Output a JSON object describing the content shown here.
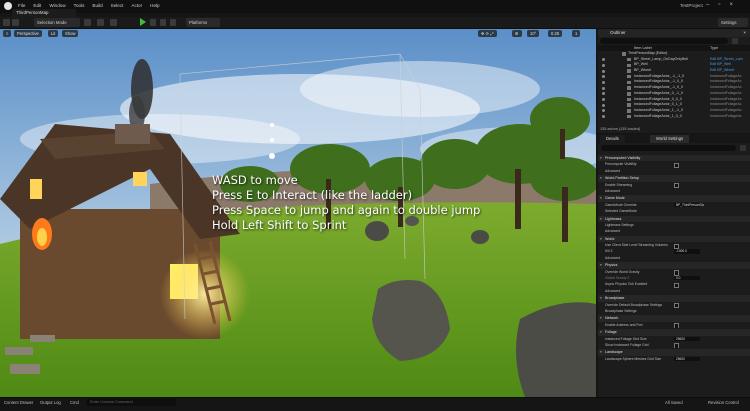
{
  "app": {
    "project_name": "TestProject",
    "map_tab": "ThirdPersonMap",
    "menu": [
      "File",
      "Edit",
      "Window",
      "Tools",
      "Build",
      "Select",
      "Actor",
      "Help"
    ]
  },
  "toolbar": {
    "mode": "Selection Mode",
    "platforms": "Platforms",
    "settings": "Settings"
  },
  "viewport": {
    "perspective": "Perspective",
    "lit": "Lit",
    "show": "Show",
    "snap_angle": "10°",
    "snap_scale": "0.25",
    "camera_speed": "1",
    "instructions": [
      "WASD to move",
      "Press E to Interact (like the ladder)",
      "Press Space to jump and  again to double jump",
      "Hold Left Shift to Sprint"
    ]
  },
  "outliner": {
    "title": "Outliner",
    "col_label": "Item Label",
    "col_type": "Type",
    "root": "ThirdPersonMap (Editor)",
    "rows": [
      {
        "label": "BP_Street_Lamp_OnDayOnlyBell",
        "type": "Edit BP_Street_Lam",
        "link": true
      },
      {
        "label": "BP_Well",
        "type": "Edit BP_Well",
        "link": true
      },
      {
        "label": "BP_Wheel",
        "type": "Edit BP_Wheel",
        "link": true
      },
      {
        "label": "InstancedFoliageActor_-1_-1_0",
        "type": "InstancedFoliageAc",
        "link": false
      },
      {
        "label": "InstancedFoliageActor_-1_0_0",
        "type": "InstancedFoliageAc",
        "link": false
      },
      {
        "label": "InstancedFoliageActor_-1_0_0",
        "type": "InstancedFoliageAc",
        "link": false
      },
      {
        "label": "InstancedFoliageActor_0_-1_0",
        "type": "InstancedFoliageAc",
        "link": false
      },
      {
        "label": "InstancedFoliageActor_0_0_0",
        "type": "InstancedFoliageAc",
        "link": false
      },
      {
        "label": "InstancedFoliageActor_0_1_0",
        "type": "InstancedFoliageAc",
        "link": false
      },
      {
        "label": "InstancedFoliageActor_1_-1_0",
        "type": "InstancedFoliageAc",
        "link": false
      },
      {
        "label": "InstancedFoliageActor_1_0_0",
        "type": "InstancedFoliageAc",
        "link": false
      }
    ],
    "status": "135 actors (135 loaded)"
  },
  "details": {
    "tab_details": "Details",
    "tab_world": "World Settings",
    "sections": [
      {
        "title": "Precomputed Visibility",
        "rows": [
          {
            "label": "Precompute Visibility",
            "kind": "check"
          },
          {
            "label": "Advanced",
            "kind": "sub"
          }
        ]
      },
      {
        "title": "World Partition Setup",
        "rows": [
          {
            "label": "Enable Streaming",
            "kind": "check"
          },
          {
            "label": "Advanced",
            "kind": "sub"
          }
        ]
      },
      {
        "title": "Game Mode",
        "rows": [
          {
            "label": "GameMode Override",
            "kind": "value",
            "value": "BP_ThirdPersonGa"
          },
          {
            "label": "Selected GameMode",
            "kind": "sub"
          }
        ]
      },
      {
        "title": "Lightmass",
        "rows": [
          {
            "label": "Lightmass Settings",
            "kind": "sub"
          },
          {
            "label": "Advanced",
            "kind": "sub"
          }
        ]
      },
      {
        "title": "World",
        "rows": [
          {
            "label": "Use Client Side Level Streaming Volumes",
            "kind": "check"
          },
          {
            "label": "Kill Z",
            "kind": "value",
            "value": "-1000.0"
          },
          {
            "label": "Advanced",
            "kind": "sub"
          }
        ]
      },
      {
        "title": "Physics",
        "rows": [
          {
            "label": "Override World Gravity",
            "kind": "check"
          },
          {
            "label": "Global Gravity Z",
            "kind": "value",
            "value": "0.0",
            "dim": true
          },
          {
            "label": "Async Physics Tick Enabled",
            "kind": "check"
          },
          {
            "label": "Advanced",
            "kind": "sub"
          }
        ]
      },
      {
        "title": "Broadphase",
        "rows": [
          {
            "label": "Override Default Broadphase Settings",
            "kind": "check"
          },
          {
            "label": "Broadphase Settings",
            "kind": "sub"
          }
        ]
      },
      {
        "title": "Network",
        "rows": [
          {
            "label": "Enable Address and Port",
            "kind": "check"
          }
        ]
      },
      {
        "title": "Foliage",
        "rows": [
          {
            "label": "Instanced Foliage Grid Size",
            "kind": "value",
            "value": "25600"
          },
          {
            "label": "Show Instanced Foliage Grid",
            "kind": "check"
          }
        ]
      },
      {
        "title": "Landscape",
        "rows": [
          {
            "label": "Landscape Sphere Meshes Grid Size",
            "kind": "value",
            "value": "25600"
          }
        ]
      }
    ]
  },
  "statusbar": {
    "content_drawer": "Content Drawer",
    "output_log": "Output Log",
    "cmd": "Cmd",
    "cmd_placeholder": "Enter Console Command",
    "all_saved": "All Saved",
    "revision_control": "Revision Control"
  },
  "colors": {
    "accent_blue": "#4d9de0",
    "play_green": "#3fbf3f",
    "instruction_text": "#ffffff"
  }
}
